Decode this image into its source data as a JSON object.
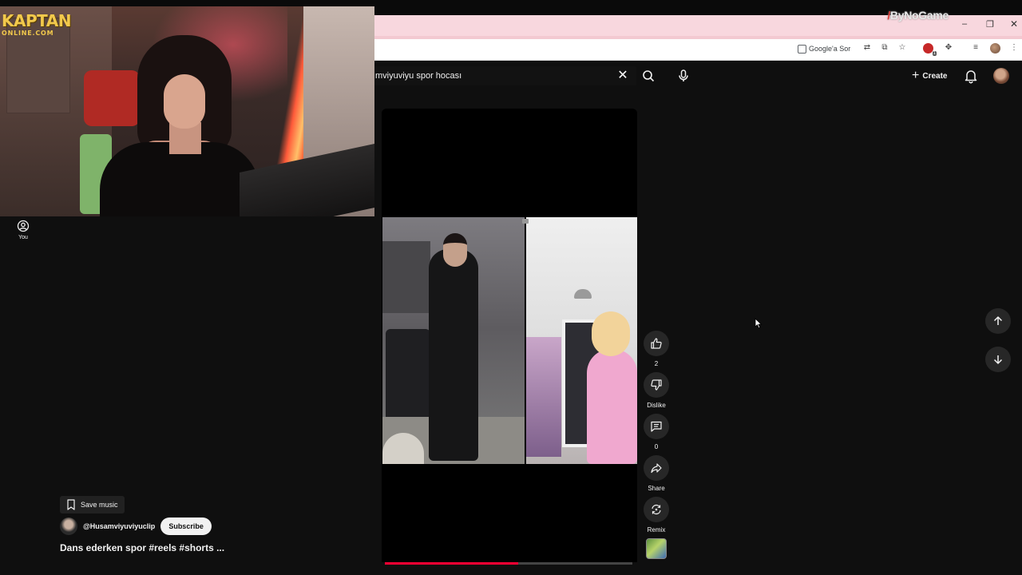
{
  "overlay": {
    "brand": "ByNoGame",
    "kaptan_line1": "KAPTAN",
    "kaptan_line2": "ONLINE.COM"
  },
  "browser": {
    "google_ask_label": "Google'a Sor",
    "extension_badge_count": "1"
  },
  "youtube": {
    "search_query": "mviyuviyu spor hocası",
    "create_label": "Create",
    "sidebar_you_label": "You"
  },
  "short": {
    "likes_count": "2",
    "dislike_label": "Dislike",
    "comments_count": "0",
    "share_label": "Share",
    "remix_label": "Remix",
    "save_music_label": "Save music",
    "channel_handle": "@Husamviyuviyuclip",
    "subscribe_label": "Subscribe",
    "title": "Dans ederken spor #reels #shorts ...",
    "progress_fraction": 0.54
  },
  "colors": {
    "background": "#0f0f0f",
    "tab_bar": "#f8d7de",
    "progress": "#ff0033",
    "action_button": "#272727"
  },
  "icons": [
    "search-icon",
    "close-icon",
    "mic-icon",
    "bell-icon",
    "like-icon",
    "dislike-icon",
    "comment-icon",
    "share-icon",
    "remix-icon",
    "bookmark-icon",
    "arrow-up-icon",
    "arrow-down-icon",
    "person-circle-icon"
  ]
}
